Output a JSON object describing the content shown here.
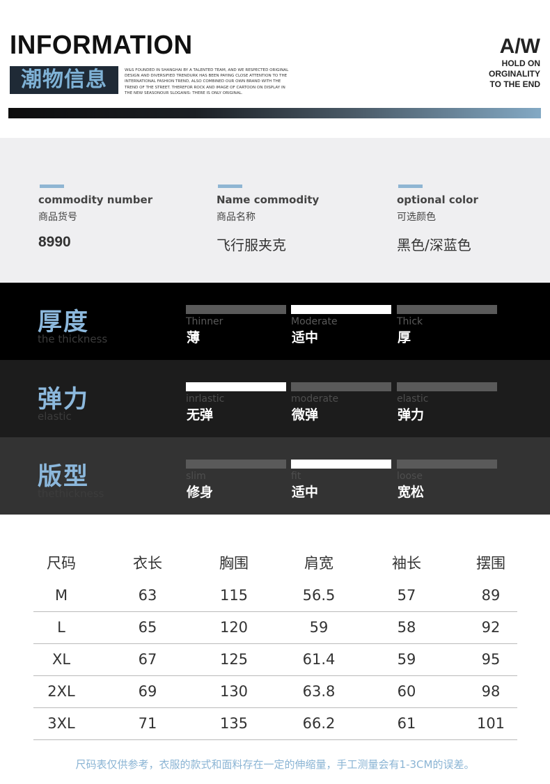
{
  "header": {
    "title": "INFORMATION",
    "badge": "潮物信息",
    "blurb": "W&S FOUNDED IN SHANGHAI BY A TALENTED TEAM, AND WE RESPECTED ORIGINAL DESIGN AND DIVERSIFIED TRENDURK HAS BEEN PAYING CLOSE ATTENTION TO THE INTERNATIONAL FASHION TREND, ALSO COMBINED OUR OWN BRAND WITH THE TREND OF THE STREET. THEREFOR ROCK AND IMAGE OF CARTOON ON DISPLAY IN THE NEW SEASONOUR SLOGANIS: THERE IS ONLY ORIGINAL.",
    "aw": "A/W",
    "tagline": [
      "HOLD ON",
      "ORGINALITY",
      "TO THE END"
    ]
  },
  "info": [
    {
      "en": "commodity number",
      "cn": "商品货号",
      "value": "8990"
    },
    {
      "en": "Name commodity",
      "cn": "商品名称",
      "value": "飞行服夹克"
    },
    {
      "en": "optional color",
      "cn": "可选颜色",
      "value": "黑色/深蓝色"
    }
  ],
  "attributes": [
    {
      "cn": "厚度",
      "en": "the thickness",
      "bg": "#000000",
      "options": [
        {
          "en": "Thinner",
          "cn": "薄",
          "selected": false
        },
        {
          "en": "Moderate",
          "cn": "适中",
          "selected": true
        },
        {
          "en": "Thick",
          "cn": "厚",
          "selected": false
        }
      ]
    },
    {
      "cn": "弹力",
      "en": "elastic",
      "bg": "#1c1c1c",
      "options": [
        {
          "en": "inrlastic",
          "cn": "无弹",
          "selected": true
        },
        {
          "en": "moderate",
          "cn": "微弹",
          "selected": false
        },
        {
          "en": "elastic",
          "cn": "弹力",
          "selected": false
        }
      ]
    },
    {
      "cn": "版型",
      "en": "thethickness",
      "bg": "#333333",
      "options": [
        {
          "en": "slim",
          "cn": "修身",
          "selected": false
        },
        {
          "en": "fit",
          "cn": "适中",
          "selected": true
        },
        {
          "en": "loose",
          "cn": "宽松",
          "selected": false
        }
      ]
    }
  ],
  "size_table": {
    "headers": [
      "尺码",
      "衣长",
      "胸围",
      "肩宽",
      "袖长",
      "摆围"
    ],
    "rows": [
      [
        "M",
        "63",
        "115",
        "56.5",
        "57",
        "89"
      ],
      [
        "L",
        "65",
        "120",
        "59",
        "58",
        "92"
      ],
      [
        "XL",
        "67",
        "125",
        "61.4",
        "59",
        "95"
      ],
      [
        "2XL",
        "69",
        "130",
        "63.8",
        "60",
        "98"
      ],
      [
        "3XL",
        "71",
        "135",
        "66.2",
        "61",
        "101"
      ]
    ]
  },
  "note": "尺码表仅供参考，衣服的款式和面料存在一定的伸缩量，手工测量会有1-3CM的误差。",
  "colors": {
    "accent": "#8cb8dc",
    "selected_bar": "#ffffff",
    "unselected_bar": "#5a5a5a"
  }
}
